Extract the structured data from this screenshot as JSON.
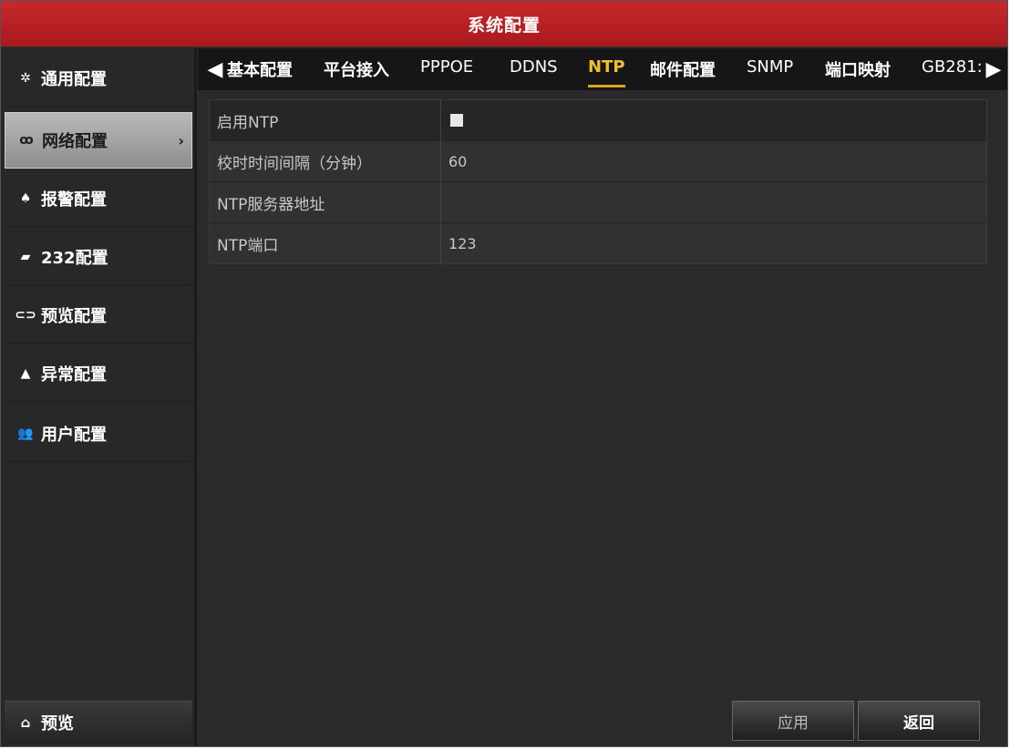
{
  "window": {
    "title": "系统配置"
  },
  "sidebar": {
    "items": [
      {
        "label": "通用配置",
        "icon": "gear-icon"
      },
      {
        "label": "网络配置",
        "icon": "network-icon",
        "active": true
      },
      {
        "label": "报警配置",
        "icon": "alarm-bell-icon"
      },
      {
        "label": "232配置",
        "icon": "serial-port-icon"
      },
      {
        "label": "预览配置",
        "icon": "eye-icon"
      },
      {
        "label": "异常配置",
        "icon": "warning-icon"
      },
      {
        "label": "用户配置",
        "icon": "users-icon"
      }
    ],
    "bottom": {
      "label": "预览",
      "icon": "home-icon"
    }
  },
  "tabs": [
    {
      "label": "基本配置"
    },
    {
      "label": "平台接入"
    },
    {
      "label": "PPPOE"
    },
    {
      "label": "DDNS"
    },
    {
      "label": "NTP",
      "active": true
    },
    {
      "label": "邮件配置"
    },
    {
      "label": "SNMP"
    },
    {
      "label": "端口映射"
    },
    {
      "label": "GB281:"
    }
  ],
  "form": {
    "rows": [
      {
        "label": "启用NTP",
        "value": "",
        "type": "checkbox",
        "checked": false
      },
      {
        "label": "校时时间间隔（分钟）",
        "value": "60"
      },
      {
        "label": "NTP服务器地址",
        "value": ""
      },
      {
        "label": "NTP端口",
        "value": "123"
      }
    ]
  },
  "buttons": {
    "apply": "应用",
    "back": "返回"
  },
  "colors": {
    "title_bar": "#b82023",
    "active_tab": "#f0c030",
    "background": "#2c2c2e"
  }
}
